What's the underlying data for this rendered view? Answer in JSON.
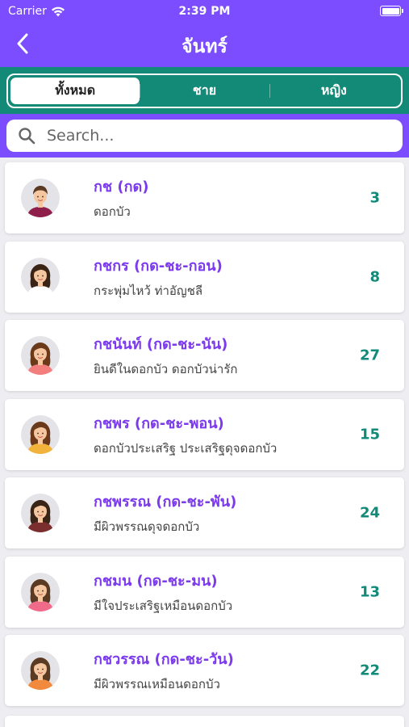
{
  "status": {
    "carrier": "Carrier",
    "time": "2:39 PM"
  },
  "header": {
    "title": "จันทร์"
  },
  "tabs": [
    {
      "label": "ทั้งหมด",
      "active": true
    },
    {
      "label": "ชาย",
      "active": false
    },
    {
      "label": "หญิง",
      "active": false
    }
  ],
  "search": {
    "placeholder": "Search..."
  },
  "colors": {
    "primary": "#7c4dff",
    "teal": "#138a78",
    "name": "#7c3aed"
  },
  "names": [
    {
      "name": "กช (กด)",
      "meaning": "ดอกบัว",
      "count": "3",
      "avatar": "male-avatar-icon",
      "hair": "#5a3a22",
      "shirt": "#8e1f4a"
    },
    {
      "name": "กชกร (กด-ชะ-กอน)",
      "meaning": "กระพุ่มไหว้ ท่าอัญชลี",
      "count": "8",
      "avatar": "female-avatar-icon",
      "hair": "#3a2415",
      "shirt": "#ffffff"
    },
    {
      "name": "กชนันท์ (กด-ชะ-นัน)",
      "meaning": "ยินดีในดอกบัว ดอกบัวน่ารัก",
      "count": "27",
      "avatar": "female-avatar-icon",
      "hair": "#6b3a1a",
      "shirt": "#f27e7e"
    },
    {
      "name": "กชพร (กด-ชะ-พอน)",
      "meaning": "ดอกบัวประเสริฐ ประเสริฐดุจดอกบัว",
      "count": "15",
      "avatar": "female-avatar-icon",
      "hair": "#6b3a1a",
      "shirt": "#f2b33d"
    },
    {
      "name": "กชพรรณ (กด-ชะ-พัน)",
      "meaning": "มีผิวพรรณดุจดอกบัว",
      "count": "24",
      "avatar": "female-avatar-icon",
      "hair": "#3a2415",
      "shirt": "#7a2e2e"
    },
    {
      "name": "กชมน (กด-ชะ-มน)",
      "meaning": "มีใจประเสริฐเหมือนดอกบัว",
      "count": "13",
      "avatar": "female-avatar-icon",
      "hair": "#5a3a22",
      "shirt": "#f06a8a"
    },
    {
      "name": "กชวรรณ (กด-ชะ-วัน)",
      "meaning": "มีผิวพรรณเหมือนดอกบัว",
      "count": "22",
      "avatar": "female-avatar-icon",
      "hair": "#5a3a22",
      "shirt": "#f28a3d"
    }
  ]
}
